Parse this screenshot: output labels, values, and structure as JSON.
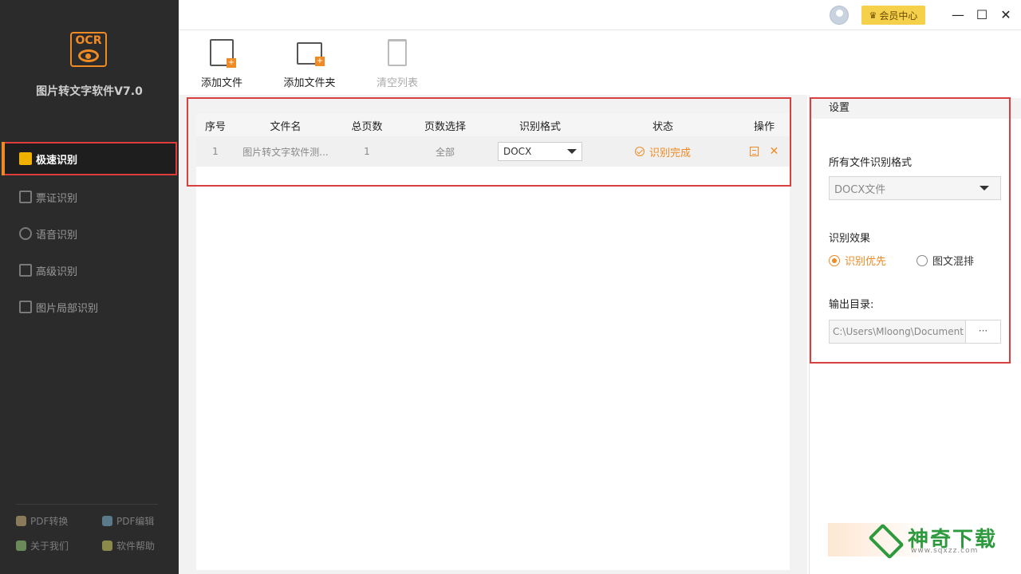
{
  "app": {
    "logo_text": "OCR",
    "title": "图片转文字软件V7.0"
  },
  "nav": {
    "items": [
      {
        "label": "极速识别",
        "icon": "lightning-icon",
        "active": true
      },
      {
        "label": "票证识别",
        "icon": "ticket-icon",
        "active": false
      },
      {
        "label": "语音识别",
        "icon": "microphone-icon",
        "active": false
      },
      {
        "label": "高级识别",
        "icon": "scan-icon",
        "active": false
      },
      {
        "label": "图片局部识别",
        "icon": "crop-icon",
        "active": false
      }
    ]
  },
  "bottom_links": [
    {
      "label": "PDF转换",
      "icon": "pdf-convert-icon"
    },
    {
      "label": "PDF编辑",
      "icon": "pdf-edit-icon"
    },
    {
      "label": "关于我们",
      "icon": "about-icon"
    },
    {
      "label": "软件帮助",
      "icon": "help-icon"
    }
  ],
  "titlebar": {
    "vip_label": "会员中心",
    "minimize": "—",
    "maximize": "☐",
    "close": "✕"
  },
  "toolbar": {
    "add_file": "添加文件",
    "add_folder": "添加文件夹",
    "clear_list": "清空列表"
  },
  "table": {
    "headers": [
      "序号",
      "文件名",
      "总页数",
      "页数选择",
      "识别格式",
      "状态",
      "操作"
    ],
    "rows": [
      {
        "index": "1",
        "filename": "图片转文字软件测...",
        "pages": "1",
        "page_select": "全部",
        "format": "DOCX",
        "status": "识别完成"
      }
    ]
  },
  "settings": {
    "title": "设置",
    "format_label": "所有文件识别格式",
    "format_value": "DOCX文件",
    "effect_label": "识别效果",
    "effect_options": [
      "识别优先",
      "图文混排"
    ],
    "effect_selected": "识别优先",
    "output_label": "输出目录:",
    "output_path": "C:\\Users\\Mloong\\Document",
    "browse_label": "···"
  },
  "watermark": {
    "text": "神奇下载",
    "url": "www.sqxzz.com"
  },
  "colors": {
    "accent": "#f08a24",
    "highlight": "#d8403f",
    "sidebar_bg": "#2b2b2b",
    "vip_bg": "#f5d04a"
  }
}
